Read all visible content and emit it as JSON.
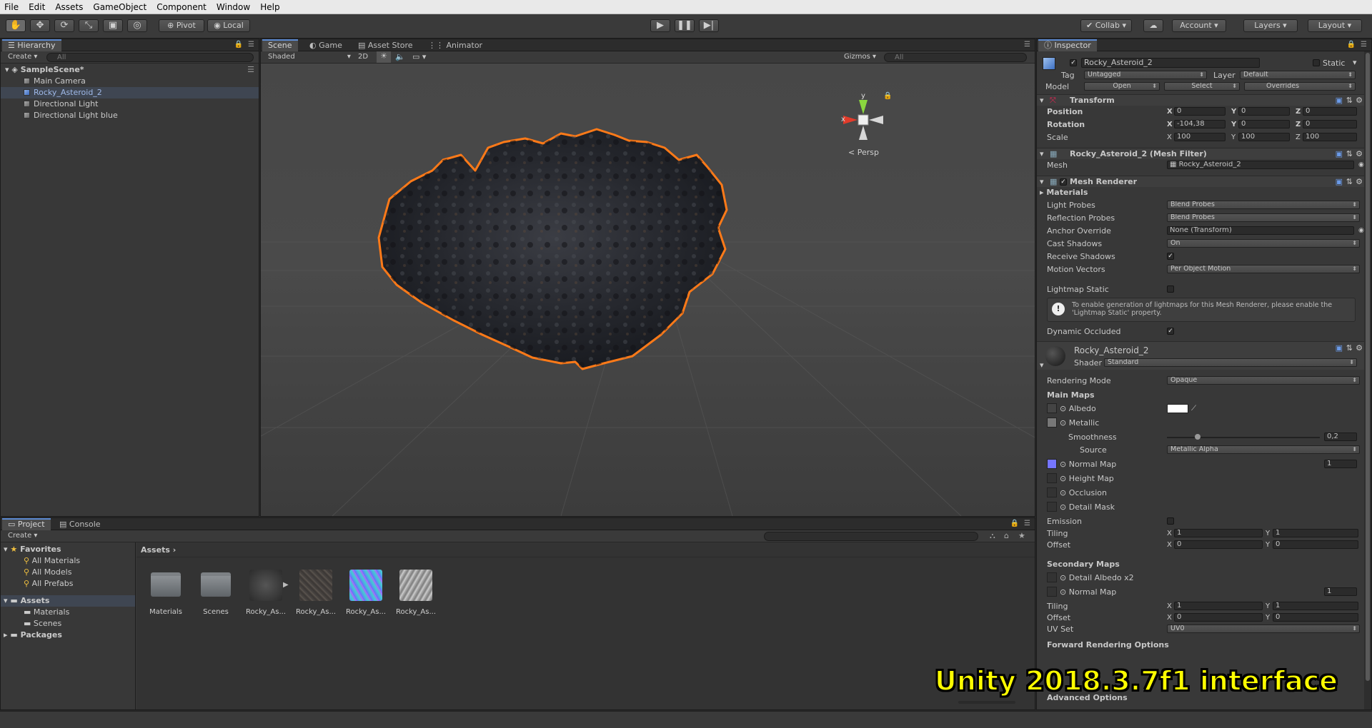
{
  "menu": [
    "File",
    "Edit",
    "Assets",
    "GameObject",
    "Component",
    "Window",
    "Help"
  ],
  "toolbar": {
    "pivot": "Pivot",
    "local": "Local",
    "collab": "Collab",
    "account": "Account",
    "layers": "Layers",
    "layout": "Layout"
  },
  "hierarchy": {
    "tab": "Hierarchy",
    "create": "Create",
    "search_placeholder": "All",
    "scene": "SampleScene*",
    "items": [
      "Main Camera",
      "Rocky_Asteroid_2",
      "Directional Light",
      "Directional Light blue"
    ]
  },
  "scene_view": {
    "tabs": [
      "Scene",
      "Game",
      "Asset Store",
      "Animator"
    ],
    "shading": "Shaded",
    "mode_2d": "2D",
    "gizmos": "Gizmos",
    "search_placeholder": "All",
    "persp": "Persp",
    "axis_x": "x",
    "axis_y": "y"
  },
  "project": {
    "tabs": [
      "Project",
      "Console"
    ],
    "create": "Create",
    "favorites": "Favorites",
    "fav_items": [
      "All Materials",
      "All Models",
      "All Prefabs"
    ],
    "assets_root": "Assets",
    "asset_folders": [
      "Materials",
      "Scenes"
    ],
    "packages": "Packages",
    "breadcrumb": "Assets",
    "grid": [
      "Materials",
      "Scenes",
      "Rocky_As...",
      "Rocky_As...",
      "Rocky_As...",
      "Rocky_As..."
    ]
  },
  "inspector": {
    "tab": "Inspector",
    "object_name": "Rocky_Asteroid_2",
    "static": "Static",
    "tag_label": "Tag",
    "tag_value": "Untagged",
    "layer_label": "Layer",
    "layer_value": "Default",
    "model_label": "Model",
    "open": "Open",
    "select": "Select",
    "overrides": "Overrides",
    "transform": {
      "title": "Transform",
      "position": {
        "label": "Position",
        "x": "0",
        "y": "0",
        "z": "0"
      },
      "rotation": {
        "label": "Rotation",
        "x": "-104,38",
        "y": "0",
        "z": "0"
      },
      "scale": {
        "label": "Scale",
        "x": "100",
        "y": "100",
        "z": "100"
      }
    },
    "mesh_filter": {
      "title": "Rocky_Asteroid_2 (Mesh Filter)",
      "mesh_label": "Mesh",
      "mesh_value": "Rocky_Asteroid_2"
    },
    "mesh_renderer": {
      "title": "Mesh Renderer",
      "materials": "Materials",
      "light_probes": {
        "label": "Light Probes",
        "value": "Blend Probes"
      },
      "reflection_probes": {
        "label": "Reflection Probes",
        "value": "Blend Probes"
      },
      "anchor_override": {
        "label": "Anchor Override",
        "value": "None (Transform)"
      },
      "cast_shadows": {
        "label": "Cast Shadows",
        "value": "On"
      },
      "receive_shadows": "Receive Shadows",
      "motion_vectors": {
        "label": "Motion Vectors",
        "value": "Per Object Motion"
      },
      "lightmap_static": "Lightmap Static",
      "help": "To enable generation of lightmaps for this Mesh Renderer, please enable the 'Lightmap Static' property.",
      "dynamic_occluded": "Dynamic Occluded"
    },
    "material": {
      "name": "Rocky_Asteroid_2",
      "shader_label": "Shader",
      "shader_value": "Standard",
      "rendering_mode": {
        "label": "Rendering Mode",
        "value": "Opaque"
      },
      "main_maps": "Main Maps",
      "albedo": "Albedo",
      "metallic": "Metallic",
      "smoothness": {
        "label": "Smoothness",
        "value": "0,2",
        "level": 0.2
      },
      "source": {
        "label": "Source",
        "value": "Metallic Alpha"
      },
      "normal_map": {
        "label": "Normal Map",
        "value": "1"
      },
      "height_map": "Height Map",
      "occlusion": "Occlusion",
      "detail_mask": "Detail Mask",
      "emission": "Emission",
      "tiling": {
        "label": "Tiling",
        "x": "1",
        "y": "1"
      },
      "offset": {
        "label": "Offset",
        "x": "0",
        "y": "0"
      },
      "secondary_maps": "Secondary Maps",
      "detail_albedo": "Detail Albedo x2",
      "sec_normal_map": {
        "label": "Normal Map",
        "value": "1"
      },
      "sec_tiling": {
        "label": "Tiling",
        "x": "1",
        "y": "1"
      },
      "sec_offset": {
        "label": "Offset",
        "x": "0",
        "y": "0"
      },
      "uv_set": {
        "label": "UV Set",
        "value": "UV0"
      },
      "forward_rendering": "Forward Rendering Options",
      "advanced": "Advanced Options"
    }
  },
  "watermark": "Unity 2018.3.7f1 interface",
  "colors": {
    "selection_outline": "#ff7a18",
    "accent": "#5d8bd2",
    "watermark": "#ffff00"
  }
}
